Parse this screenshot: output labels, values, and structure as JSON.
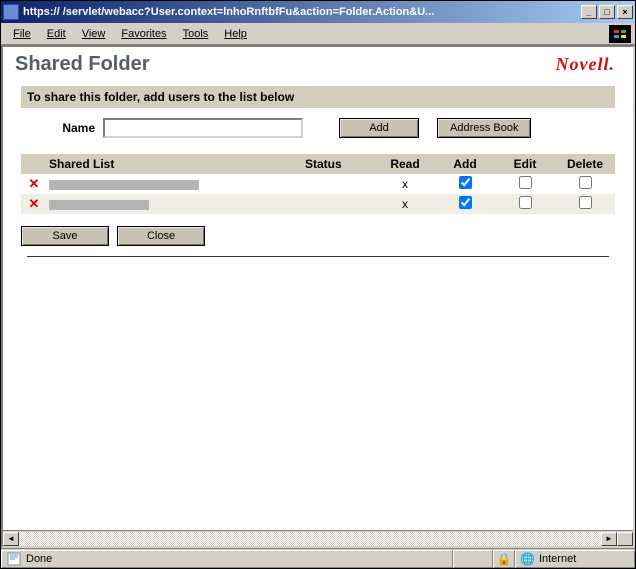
{
  "window": {
    "url_visible": "https://        /servlet/webacc?User.context=lnhoRnftbfFu&action=Folder.Action&U...",
    "min": "_",
    "max": "□",
    "close": "×"
  },
  "menus": {
    "file": "File",
    "edit": "Edit",
    "view": "View",
    "favorites": "Favorites",
    "tools": "Tools",
    "help": "Help"
  },
  "page": {
    "title": "Shared Folder",
    "brand": "Novell.",
    "instruction": "To share this folder, add users to the list below",
    "name_label": "Name",
    "name_value": "",
    "add_button": "Add",
    "address_book_button": "Address Book"
  },
  "table": {
    "headers": {
      "shared_list": "Shared List",
      "status": "Status",
      "read": "Read",
      "add": "Add",
      "edit": "Edit",
      "delete": "Delete"
    },
    "rows": [
      {
        "remove": "✕",
        "name_redacted_width": 150,
        "status": "",
        "read": "x",
        "add": true,
        "edit": false,
        "delete": false
      },
      {
        "remove": "✕",
        "name_redacted_width": 100,
        "status": "",
        "read": "x",
        "add": true,
        "edit": false,
        "delete": false
      }
    ]
  },
  "actions": {
    "save": "Save",
    "close_btn": "Close"
  },
  "status": {
    "done": "Done",
    "zone": "Internet"
  }
}
